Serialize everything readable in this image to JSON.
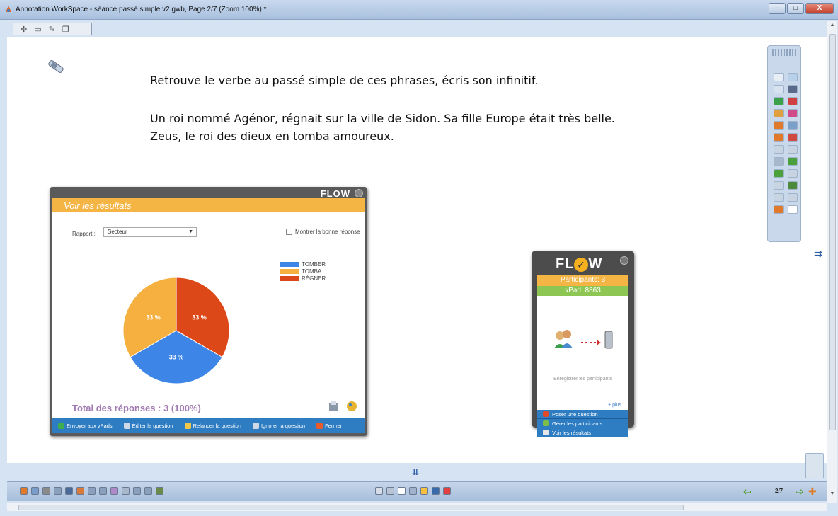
{
  "window": {
    "title": "Annotation WorkSpace - séance passé simple v2.gwb, Page 2/7  (Zoom 100%) *",
    "minimize": "–",
    "maximize": "□",
    "close": "X"
  },
  "page": {
    "instruction": "Retrouve le verbe au passé simple de ces phrases, écris son infinitif.",
    "passage": "Un roi nommé Agénor, régnait sur la ville de Sidon. Sa fille Europe était très belle. Zeus, le roi des dieux en tomba amoureux."
  },
  "results_window": {
    "brand": "FLOW",
    "header": "Voir les résultats",
    "rapport_label": "Rapport :",
    "rapport_value": "Secteur",
    "show_answer_label": "Montrer la bonne réponse",
    "total": "Total des réponses : 3 (100%)",
    "footer_buttons": [
      {
        "label": "Envoyer aux vPads",
        "color": "#3fae4f"
      },
      {
        "label": "Éditer la question",
        "color": "#cfd8e6"
      },
      {
        "label": "Relancer la question",
        "color": "#f2c84b"
      },
      {
        "label": "Ignorer la question",
        "color": "#cfd8e6"
      },
      {
        "label": "Fermer",
        "color": "#e85a2a"
      }
    ]
  },
  "chart_data": {
    "type": "pie",
    "categories": [
      "TOMBER",
      "TOMBA",
      "RÉGNER"
    ],
    "values": [
      33,
      33,
      33
    ],
    "labels": [
      "33 %",
      "33 %",
      "33 %"
    ],
    "colors": [
      "#3d86e8",
      "#f5b040",
      "#dc4818"
    ],
    "legend_placement": "right"
  },
  "flow_widget": {
    "brand_left": "FL",
    "brand_o": "✓",
    "brand_right": "W",
    "participants": "Participants: 3",
    "vpad": "vPad: 8863",
    "register_label": "Enregistrer les participants",
    "plus": "+ plus",
    "menu": [
      {
        "label": "Poser une question",
        "color": "#e04a2a"
      },
      {
        "label": "Gérer les participants",
        "color": "#7cc04a"
      },
      {
        "label": "Voir les résultats",
        "color": "#e6e6e6"
      }
    ]
  },
  "bottom_bar": {
    "page_counter": "2/7",
    "left_tool_colors": [
      "#e07a2a",
      "#7a9cc8",
      "#8a8a8a",
      "#8aa0bc",
      "#4a6a9a",
      "#d87a3a",
      "#8aa0bc",
      "#8aa0bc",
      "#b08ac8",
      "#a8b8cc",
      "#8aa0bc",
      "#8aa0bc",
      "#6a8a4a"
    ],
    "mid_tool_colors": [
      "#d6dde8",
      "#b8c4d6",
      "#ffffff",
      "#9fb3cc",
      "#f5c040",
      "#3a6aaa",
      "#e04040"
    ]
  },
  "side_tool_colors": [
    "#e8eef6",
    "#b8d0ea",
    "#d8e2ee",
    "#5a6a8a",
    "#3aa04a",
    "#d04040",
    "#e0a040",
    "#d04a8a",
    "#e07a2a",
    "#7aa0c8",
    "#e07a2a",
    "#d04a40",
    "#c8d4e2",
    "#c8d4e2",
    "#a8b8cc",
    "#4aa03a",
    "#4aa03a",
    "#c8d4e2",
    "#c8d4e2",
    "#4a8a3a",
    "#c8d4e2",
    "#c8d4e2",
    "#e07a2a",
    "#ffffff"
  ]
}
